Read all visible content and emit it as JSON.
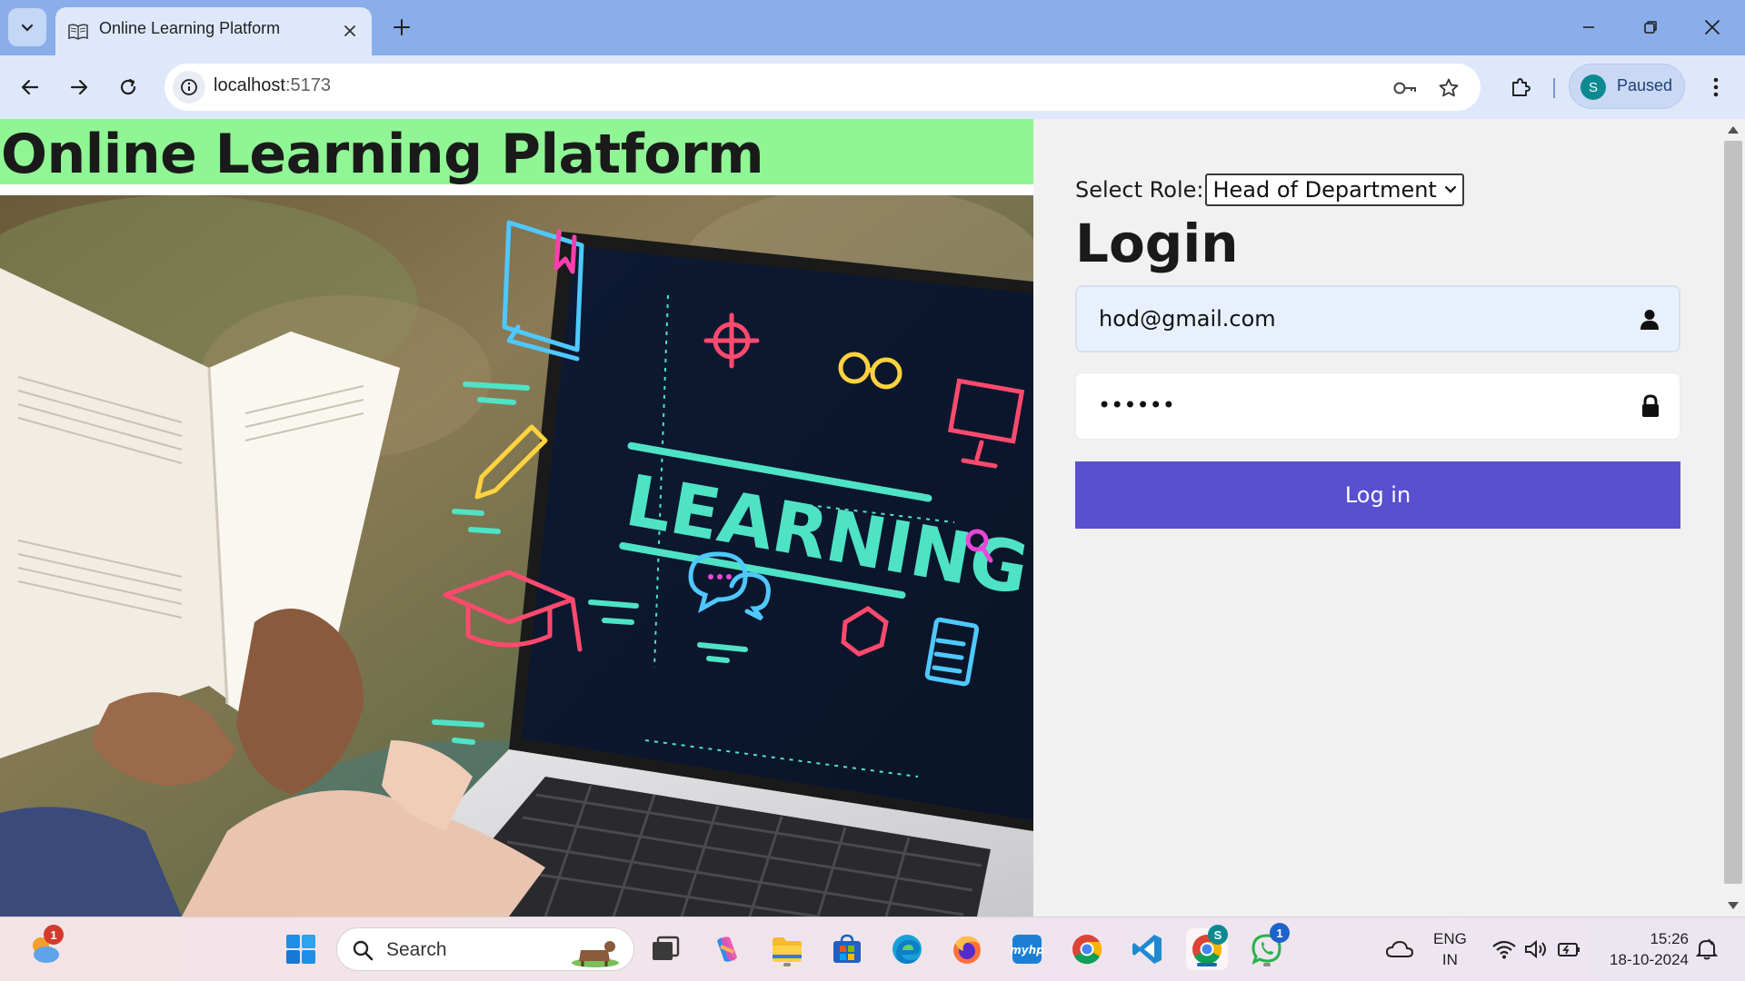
{
  "browser": {
    "tab": {
      "title": "Online Learning Platform"
    },
    "address": {
      "host": "localhost",
      "port": ":5173"
    },
    "profile": {
      "initial": "S",
      "status": "Paused"
    }
  },
  "page": {
    "site_title": "Online Learning Platform",
    "hero_image_text": "LEARNING",
    "login": {
      "role_label": "Select Role:",
      "role_selected": "Head of Department",
      "heading": "Login",
      "email_value": "hod@gmail.com",
      "password_masked": "••••••",
      "submit_label": "Log in"
    }
  },
  "taskbar": {
    "weather_badge": "1",
    "search_placeholder": "Search",
    "chrome_profile_badge": "S",
    "whatsapp_badge": "1",
    "lang_line1": "ENG",
    "lang_line2": "IN",
    "time": "15:26",
    "date": "18-10-2024"
  },
  "colors": {
    "header_bg": "#90f595",
    "login_button": "#5a4fcf",
    "email_autofill_bg": "#e8f0fe",
    "browser_frame": "#8aaeea",
    "toolbar": "#dfe8fb"
  }
}
